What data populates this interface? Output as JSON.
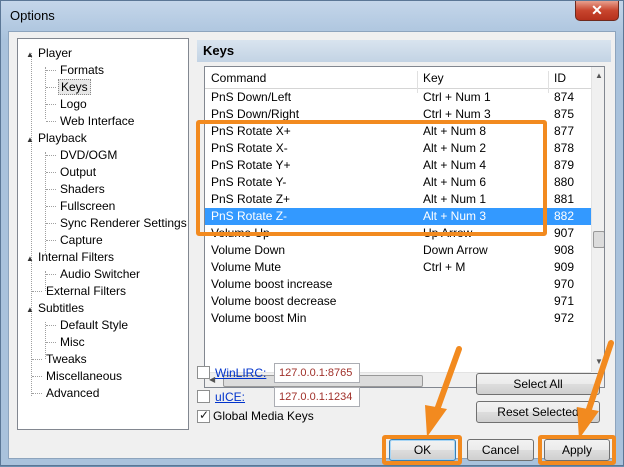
{
  "window": {
    "title": "Options",
    "close_glyph": "✕"
  },
  "tree": {
    "items": [
      {
        "label": "Player",
        "level": 0,
        "expander": "▲"
      },
      {
        "label": "Formats",
        "level": 1
      },
      {
        "label": "Keys",
        "level": 1,
        "selected": true
      },
      {
        "label": "Logo",
        "level": 1
      },
      {
        "label": "Web Interface",
        "level": 1
      },
      {
        "label": "Playback",
        "level": 0,
        "expander": "▲"
      },
      {
        "label": "DVD/OGM",
        "level": 1
      },
      {
        "label": "Output",
        "level": 1
      },
      {
        "label": "Shaders",
        "level": 1
      },
      {
        "label": "Fullscreen",
        "level": 1
      },
      {
        "label": "Sync Renderer Settings",
        "level": 1
      },
      {
        "label": "Capture",
        "level": 1
      },
      {
        "label": "Internal Filters",
        "level": 0,
        "expander": "▲"
      },
      {
        "label": "Audio Switcher",
        "level": 1
      },
      {
        "label": "External Filters",
        "level": 0
      },
      {
        "label": "Subtitles",
        "level": 0,
        "expander": "▲"
      },
      {
        "label": "Default Style",
        "level": 1
      },
      {
        "label": "Misc",
        "level": 1
      },
      {
        "label": "Tweaks",
        "level": 0
      },
      {
        "label": "Miscellaneous",
        "level": 0
      },
      {
        "label": "Advanced",
        "level": 0
      }
    ]
  },
  "page": {
    "header": "Keys"
  },
  "grid": {
    "columns": [
      "Command",
      "Key",
      "ID"
    ],
    "rows": [
      {
        "command": "PnS Down/Left",
        "key": "Ctrl + Num 1",
        "id": "874"
      },
      {
        "command": "PnS Down/Right",
        "key": "Ctrl + Num 3",
        "id": "875"
      },
      {
        "command": "PnS Rotate X+",
        "key": "Alt + Num 8",
        "id": "877"
      },
      {
        "command": "PnS Rotate X-",
        "key": "Alt + Num 2",
        "id": "878"
      },
      {
        "command": "PnS Rotate Y+",
        "key": "Alt + Num 4",
        "id": "879"
      },
      {
        "command": "PnS Rotate Y-",
        "key": "Alt + Num 6",
        "id": "880"
      },
      {
        "command": "PnS Rotate Z+",
        "key": "Alt + Num 1",
        "id": "881"
      },
      {
        "command": "PnS Rotate Z-",
        "key": "Alt + Num 3",
        "id": "882",
        "selected": true
      },
      {
        "command": "Volume Up",
        "key": "Up Arrow",
        "id": "907"
      },
      {
        "command": "Volume Down",
        "key": "Down Arrow",
        "id": "908"
      },
      {
        "command": "Volume Mute",
        "key": "Ctrl + M",
        "id": "909"
      },
      {
        "command": "Volume boost increase",
        "key": "",
        "id": "970"
      },
      {
        "command": "Volume boost decrease",
        "key": "",
        "id": "971"
      },
      {
        "command": "Volume boost Min",
        "key": "",
        "id": "972"
      }
    ],
    "hscroll_thumb_grip": "III"
  },
  "remote": {
    "winlirc": {
      "label": "WinLIRC:",
      "address": "127.0.0.1:8765",
      "checked": false
    },
    "uice": {
      "label": "uICE:",
      "address": "127.0.0.1:1234",
      "checked": false
    },
    "global_media_keys": {
      "label": "Global Media Keys",
      "checked": true
    }
  },
  "buttons": {
    "select_all": "Select All",
    "reset_selected": "Reset Selected",
    "ok": "OK",
    "cancel": "Cancel",
    "apply": "Apply"
  },
  "colors": {
    "highlight_orange": "#f28a1f",
    "selection_blue": "#3399ff",
    "address_red": "#a0302a"
  },
  "glyphs": {
    "check": "✓",
    "arrow_up": "▲",
    "arrow_down": "▼",
    "arrow_left": "◀",
    "arrow_right": "▶"
  }
}
